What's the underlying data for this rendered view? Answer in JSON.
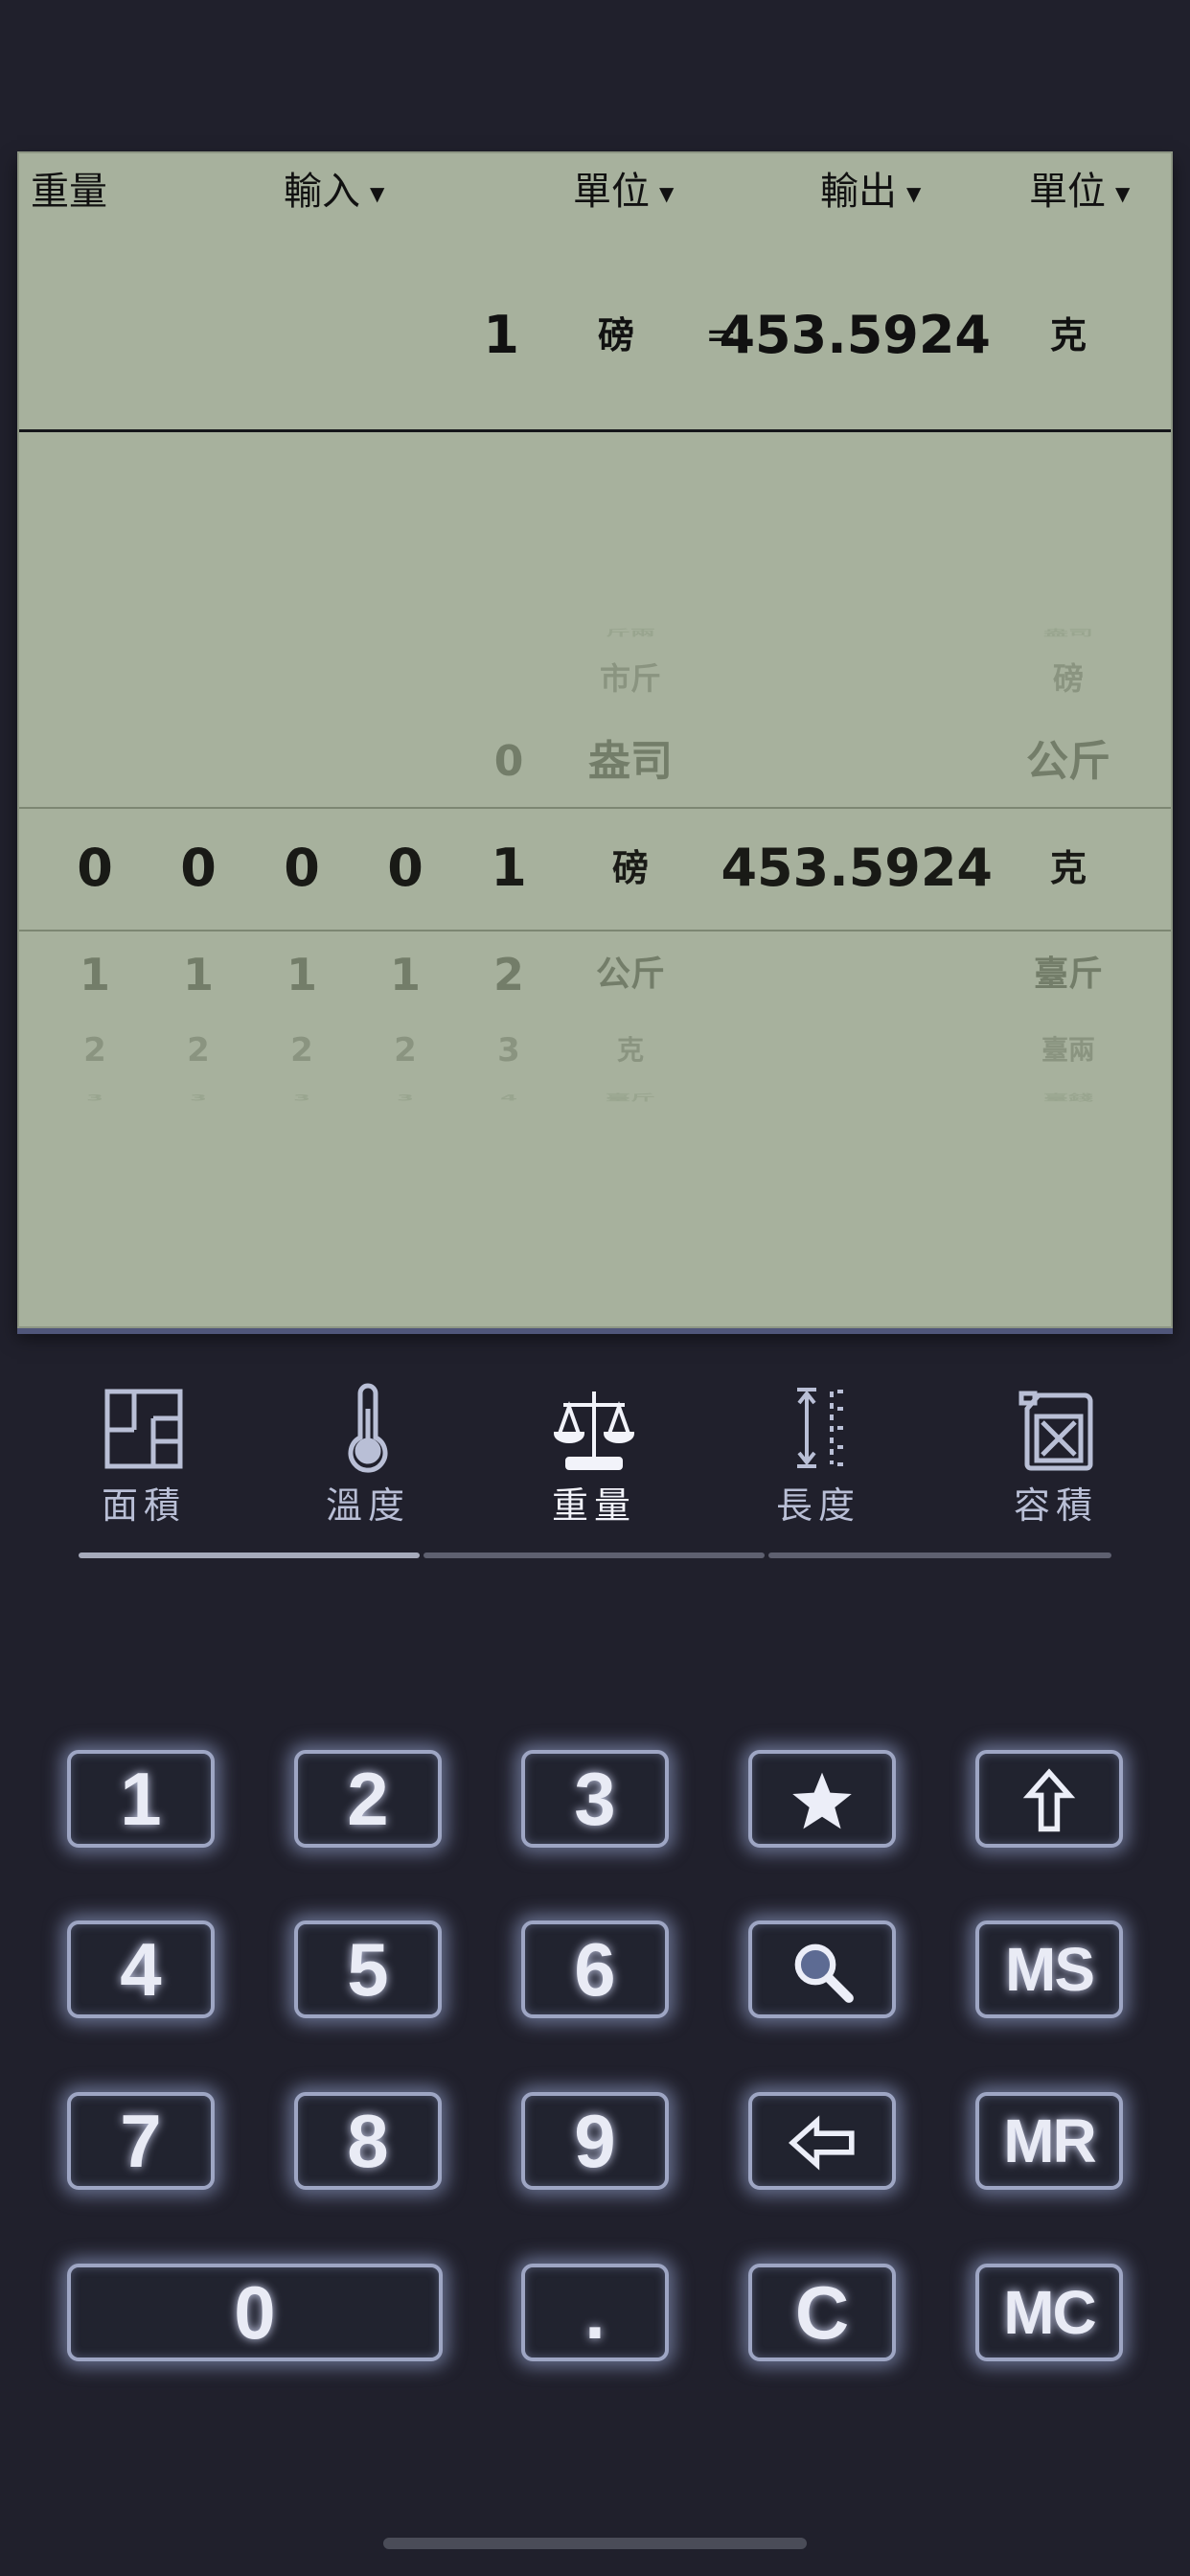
{
  "header": {
    "title": "重量",
    "input_label": "輸入",
    "unit1_label": "單位",
    "output_label": "輸出",
    "unit2_label": "單位",
    "dropdown_glyph": "▼"
  },
  "result": {
    "input_value": "1",
    "input_unit": "磅",
    "equals": "=",
    "output_value": "453.5924",
    "output_unit": "克"
  },
  "wheel": {
    "row_m3": {
      "input_unit": "斤兩",
      "output_unit": "盎司"
    },
    "row_m2": {
      "input_unit": "市斤",
      "output_unit": "磅"
    },
    "row_m1": {
      "digit5": "0",
      "input_unit": "盎司",
      "output_unit": "公斤"
    },
    "row_0": {
      "digits": [
        "0",
        "0",
        "0",
        "0",
        "1"
      ],
      "input_unit": "磅",
      "output_value": "453.5924",
      "output_unit": "克"
    },
    "row_p1": {
      "digits": [
        "1",
        "1",
        "1",
        "1",
        "2"
      ],
      "input_unit": "公斤",
      "output_unit": "臺斤"
    },
    "row_p2": {
      "digits": [
        "2",
        "2",
        "2",
        "2",
        "3"
      ],
      "input_unit": "克",
      "output_unit": "臺兩"
    },
    "row_p3": {
      "digits": [
        "3",
        "3",
        "3",
        "3",
        "4"
      ],
      "input_unit": "臺斤",
      "output_unit": "臺錢"
    }
  },
  "tabs": [
    {
      "label": "面積",
      "icon": "floorplan-icon"
    },
    {
      "label": "溫度",
      "icon": "thermometer-icon"
    },
    {
      "label": "重量",
      "icon": "scale-icon",
      "active": true
    },
    {
      "label": "長度",
      "icon": "ruler-icon"
    },
    {
      "label": "容積",
      "icon": "jerrycan-icon"
    }
  ],
  "keypad": {
    "k1": "1",
    "k2": "2",
    "k3": "3",
    "k4": "4",
    "k5": "5",
    "k6": "6",
    "k7": "7",
    "k8": "8",
    "k9": "9",
    "k0": "0",
    "dot": ".",
    "clear": "C",
    "ms": "MS",
    "mr": "MR",
    "mc": "MC"
  }
}
